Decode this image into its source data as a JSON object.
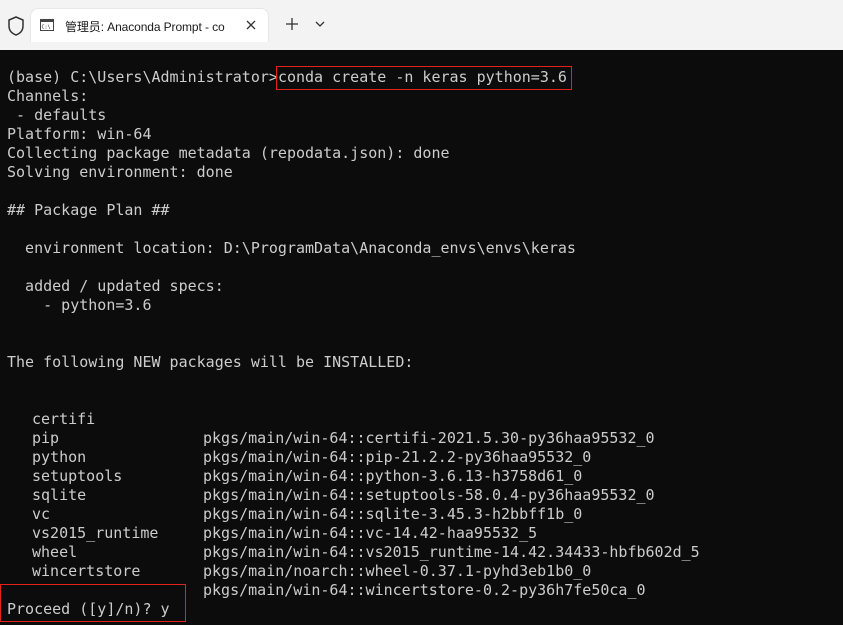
{
  "window": {
    "tab_title": "管理员: Anaconda Prompt - co",
    "icons": [
      "shield-icon",
      "cmd-icon",
      "close-icon",
      "plus-icon",
      "chevron-down-icon"
    ]
  },
  "terminal": {
    "prompt": "(base) C:\\Users\\Administrator>",
    "command": "conda create -n keras python=3.6",
    "lines": {
      "channels": "Channels:",
      "defaults": " - defaults",
      "platform": "Platform: win-64",
      "collecting": "Collecting package metadata (repodata.json): done",
      "solving": "Solving environment: done",
      "plan_header": "## Package Plan ##",
      "env_location": "  environment location: D:\\ProgramData\\Anaconda_envs\\envs\\keras",
      "specs_header": "  added / updated specs:",
      "spec_python": "    - python=3.6",
      "install_header": "The following NEW packages will be INSTALLED:",
      "proceed": "Proceed ([y]/n)? y"
    },
    "packages": [
      {
        "name": "certifi",
        "source": "pkgs/main/win-64::certifi-2021.5.30-py36haa95532_0"
      },
      {
        "name": "pip",
        "source": "pkgs/main/win-64::pip-21.2.2-py36haa95532_0"
      },
      {
        "name": "python",
        "source": "pkgs/main/win-64::python-3.6.13-h3758d61_0"
      },
      {
        "name": "setuptools",
        "source": "pkgs/main/win-64::setuptools-58.0.4-py36haa95532_0"
      },
      {
        "name": "sqlite",
        "source": "pkgs/main/win-64::sqlite-3.45.3-h2bbff1b_0"
      },
      {
        "name": "vc",
        "source": "pkgs/main/win-64::vc-14.42-haa95532_5"
      },
      {
        "name": "vs2015_runtime",
        "source": "pkgs/main/win-64::vs2015_runtime-14.42.34433-hbfb602d_5"
      },
      {
        "name": "wheel",
        "source": "pkgs/main/noarch::wheel-0.37.1-pyhd3eb1b0_0"
      },
      {
        "name": "wincertstore",
        "source": "pkgs/main/win-64::wincertstore-0.2-py36h7fe50ca_0"
      }
    ]
  },
  "colors": {
    "terminal_bg": "#0c0c0c",
    "terminal_fg": "#cccccc",
    "highlight_box": "#e2231a",
    "titlebar_bg": "#f3f3f3"
  }
}
